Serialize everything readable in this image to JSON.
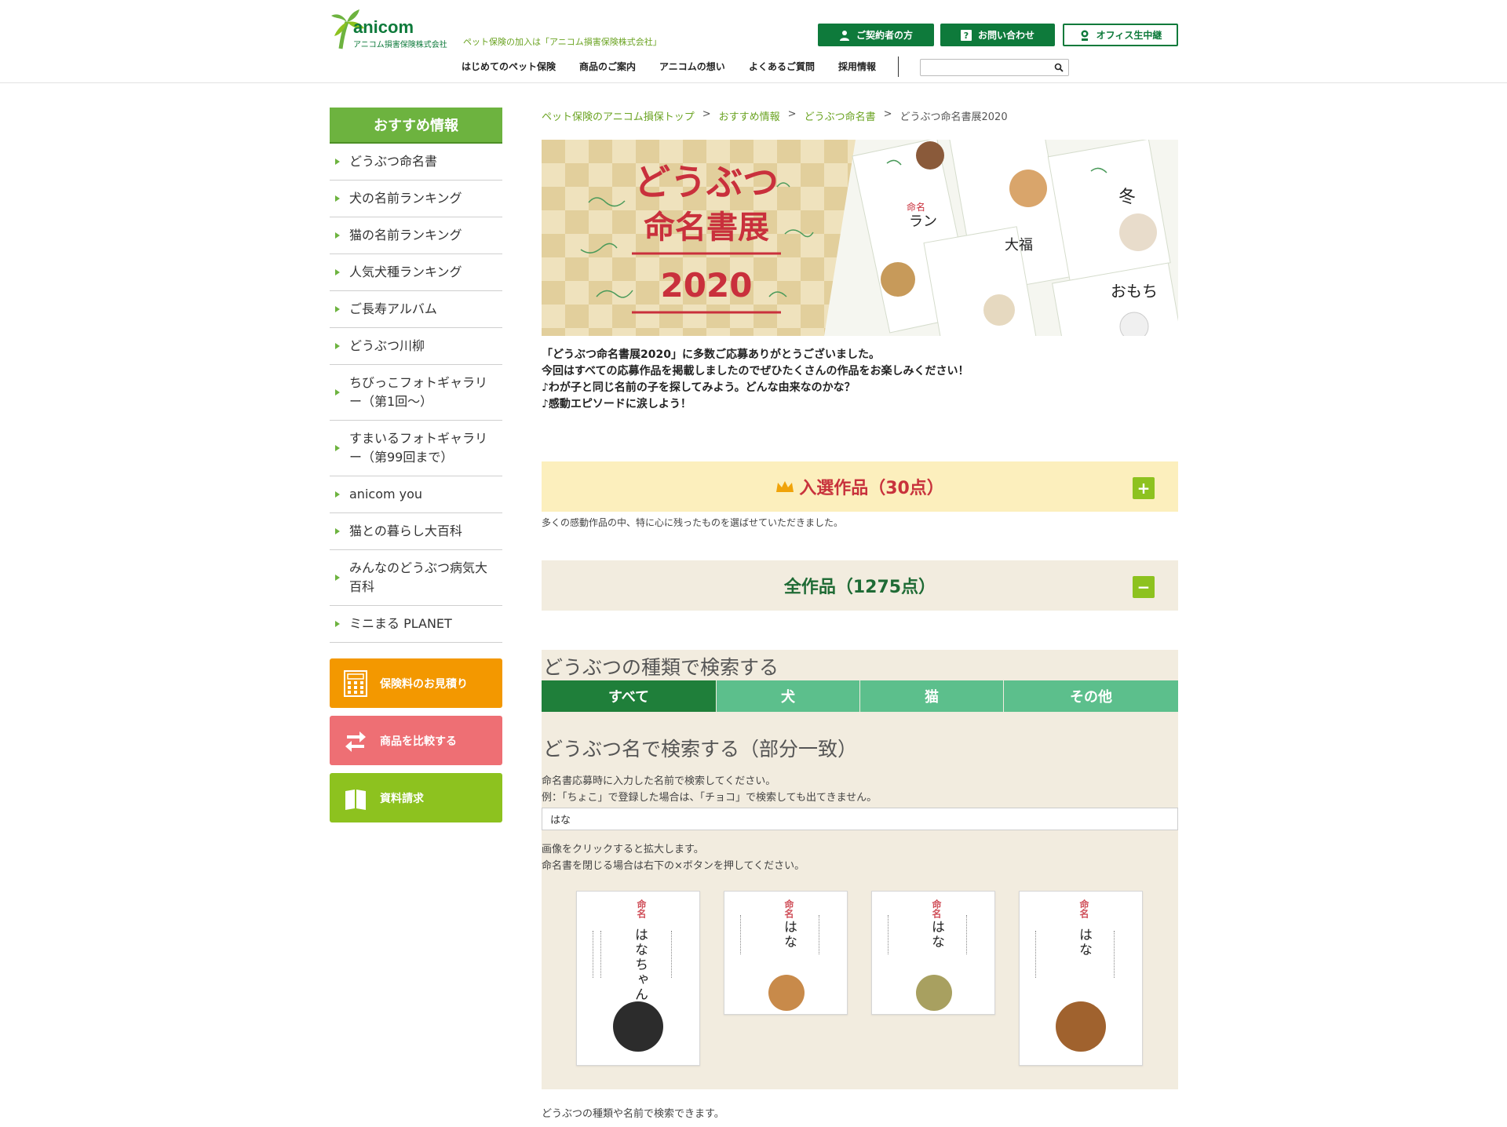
{
  "header": {
    "logo_text": "anicom",
    "logo_sub": "アニコム損害保険株式会社",
    "tagline": "ペット保険の加入は「アニコム損害保険株式会社」",
    "buttons": [
      {
        "label": "ご契約者の方",
        "icon": "person-icon"
      },
      {
        "label": "お問い合わせ",
        "icon": "question-icon"
      },
      {
        "label": "オフィス生中継",
        "icon": "camera-icon"
      }
    ],
    "nav": [
      "はじめてのペット保険",
      "商品のご案内",
      "アニコムの想い",
      "よくあるご質問",
      "採用情報"
    ],
    "search": {
      "placeholder": "",
      "value": ""
    }
  },
  "sidebar": {
    "heading": "おすすめ情報",
    "items": [
      "どうぶつ命名書",
      "犬の名前ランキング",
      "猫の名前ランキング",
      "人気犬種ランキング",
      "ご長寿アルバム",
      "どうぶつ川柳",
      "ちびっこフォトギャラリー（第1回〜）",
      "すまいるフォトギャラリー（第99回まで）",
      "anicom you",
      "猫との暮らし大百科",
      "みんなのどうぶつ病気大百科",
      "ミニまる PLANET"
    ],
    "cta": [
      {
        "label": "保険料のお見積り",
        "icon": "calculator-icon",
        "color": "#f39800"
      },
      {
        "label": "商品を比較する",
        "icon": "compare-arrows-icon",
        "color": "#ee6f74"
      },
      {
        "label": "資料請求",
        "icon": "book-icon",
        "color": "#8dc21f"
      }
    ]
  },
  "breadcrumb": [
    "ペット保険のアニコム損保トップ",
    "おすすめ情報",
    "どうぶつ命名書",
    "どうぶつ命名書展2020"
  ],
  "hero": {
    "title_line1": "どうぶつ",
    "title_line2": "命名書展",
    "year": "2020",
    "sample_names": [
      "ラン",
      "大福",
      "冬",
      "おもち"
    ],
    "mei_label": "命名"
  },
  "intro": [
    "「どうぶつ命名書展2020」に多数ご応募ありがとうございました。",
    "今回はすべての応募作品を掲載しましたのでぜひたくさんの作品をお楽しみください！",
    "♪わが子と同じ名前の子を探してみよう。どんな由来なのかな？",
    "♪感動エピソードに涙しよう！"
  ],
  "accordions": {
    "selected": {
      "label": "入選作品（30点）",
      "toggle": "+",
      "note": "多くの感動作品の中、特に心に残ったものを選ばせていただきました。",
      "bg": "#fcefbd",
      "color": "#c8323c"
    },
    "all": {
      "label": "全作品（1275点）",
      "toggle": "−",
      "bg": "#f2ecdf",
      "color": "#1f6b35"
    }
  },
  "search": {
    "by_type_title": "どうぶつの種類で検索する",
    "tabs": [
      "すべて",
      "犬",
      "猫",
      "その他"
    ],
    "active_tab": "すべて",
    "by_name_title": "どうぶつ名で検索する（部分一致）",
    "help1": "命名書応募時に入力した名前で検索してください。",
    "help2": "例：「ちょこ」で登録した場合は、「チョコ」で検索しても出てきません。",
    "input_value": "はな",
    "click_help1": "画像をクリックすると拡大します。",
    "click_help2": "命名書を閉じる場合は右下の×ボタンを押してください。"
  },
  "results": [
    {
      "name": "はなちゃん",
      "mei": "命名"
    },
    {
      "name": "はな",
      "mei": "命名"
    },
    {
      "name": "はな",
      "mei": "命名"
    },
    {
      "name": "はな",
      "mei": "命名"
    }
  ],
  "footer_note": "どうぶつの種類や名前で検索できます。"
}
